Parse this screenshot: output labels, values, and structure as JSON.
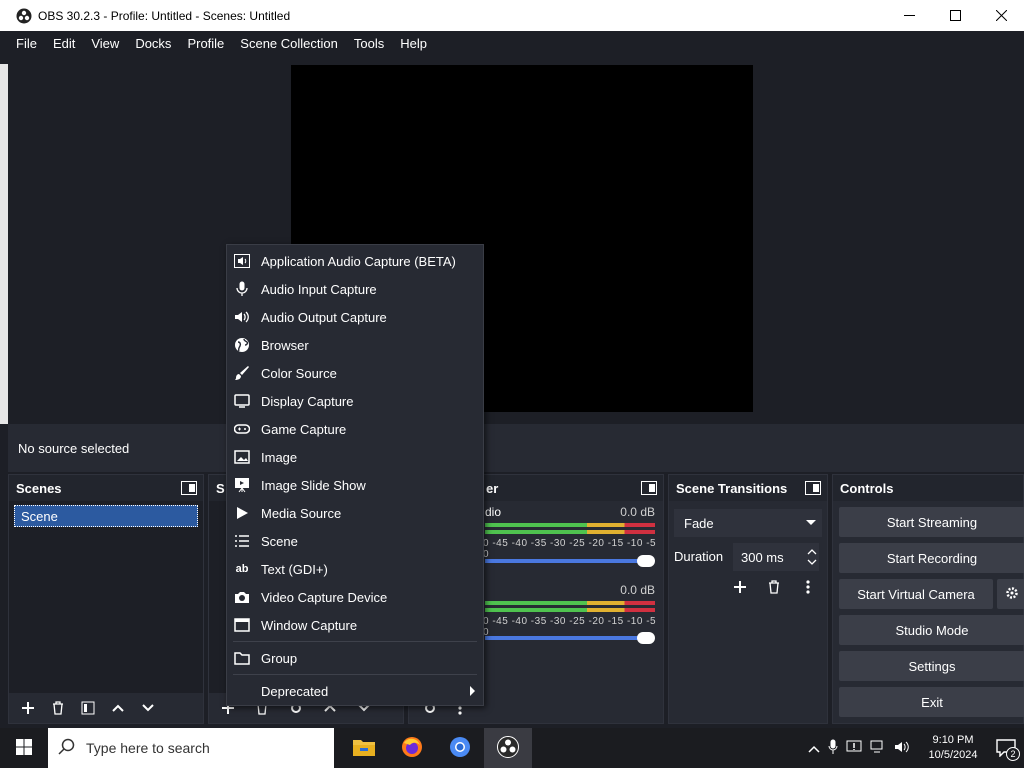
{
  "window": {
    "title": "OBS 30.2.3 - Profile: Untitled - Scenes: Untitled"
  },
  "menubar": [
    "File",
    "Edit",
    "View",
    "Docks",
    "Profile",
    "Scene Collection",
    "Tools",
    "Help"
  ],
  "source_bar": {
    "text": "No source selected"
  },
  "docks": {
    "scenes": {
      "title": "Scenes",
      "items": [
        "Scene"
      ]
    },
    "sources": {
      "title_partial": "S"
    },
    "mixer": {
      "title_partial": "er",
      "tracks": [
        {
          "name_partial": "dio",
          "db": "0.0 dB"
        },
        {
          "name_partial": "",
          "db": "0.0 dB"
        }
      ],
      "scale": "0 -45 -40 -35 -30 -25 -20 -15 -10 -5 0"
    },
    "transitions": {
      "title": "Scene Transitions",
      "selected": "Fade",
      "duration_label": "Duration",
      "duration_value": "300 ms"
    },
    "controls": {
      "title": "Controls",
      "buttons": [
        "Start Streaming",
        "Start Recording",
        "Start Virtual Camera",
        "Studio Mode",
        "Settings",
        "Exit"
      ]
    }
  },
  "context_menu": {
    "items": [
      {
        "label": "Application Audio Capture (BETA)",
        "icon": "app-audio-icon"
      },
      {
        "label": "Audio Input Capture",
        "icon": "microphone-icon"
      },
      {
        "label": "Audio Output Capture",
        "icon": "speaker-icon"
      },
      {
        "label": "Browser",
        "icon": "globe-icon"
      },
      {
        "label": "Color Source",
        "icon": "brush-icon"
      },
      {
        "label": "Display Capture",
        "icon": "monitor-icon"
      },
      {
        "label": "Game Capture",
        "icon": "gamepad-icon"
      },
      {
        "label": "Image",
        "icon": "image-icon"
      },
      {
        "label": "Image Slide Show",
        "icon": "slideshow-icon"
      },
      {
        "label": "Media Source",
        "icon": "play-icon"
      },
      {
        "label": "Scene",
        "icon": "list-icon"
      },
      {
        "label": "Text (GDI+)",
        "icon": "text-icon"
      },
      {
        "label": "Video Capture Device",
        "icon": "camera-icon"
      },
      {
        "label": "Window Capture",
        "icon": "window-icon"
      },
      {
        "label": "Group",
        "icon": "folder-icon"
      },
      {
        "label": "Deprecated",
        "icon": ""
      }
    ]
  },
  "taskbar": {
    "search_placeholder": "Type here to search",
    "clock_time": "9:10 PM",
    "clock_date": "10/5/2024",
    "notification_count": "2"
  }
}
